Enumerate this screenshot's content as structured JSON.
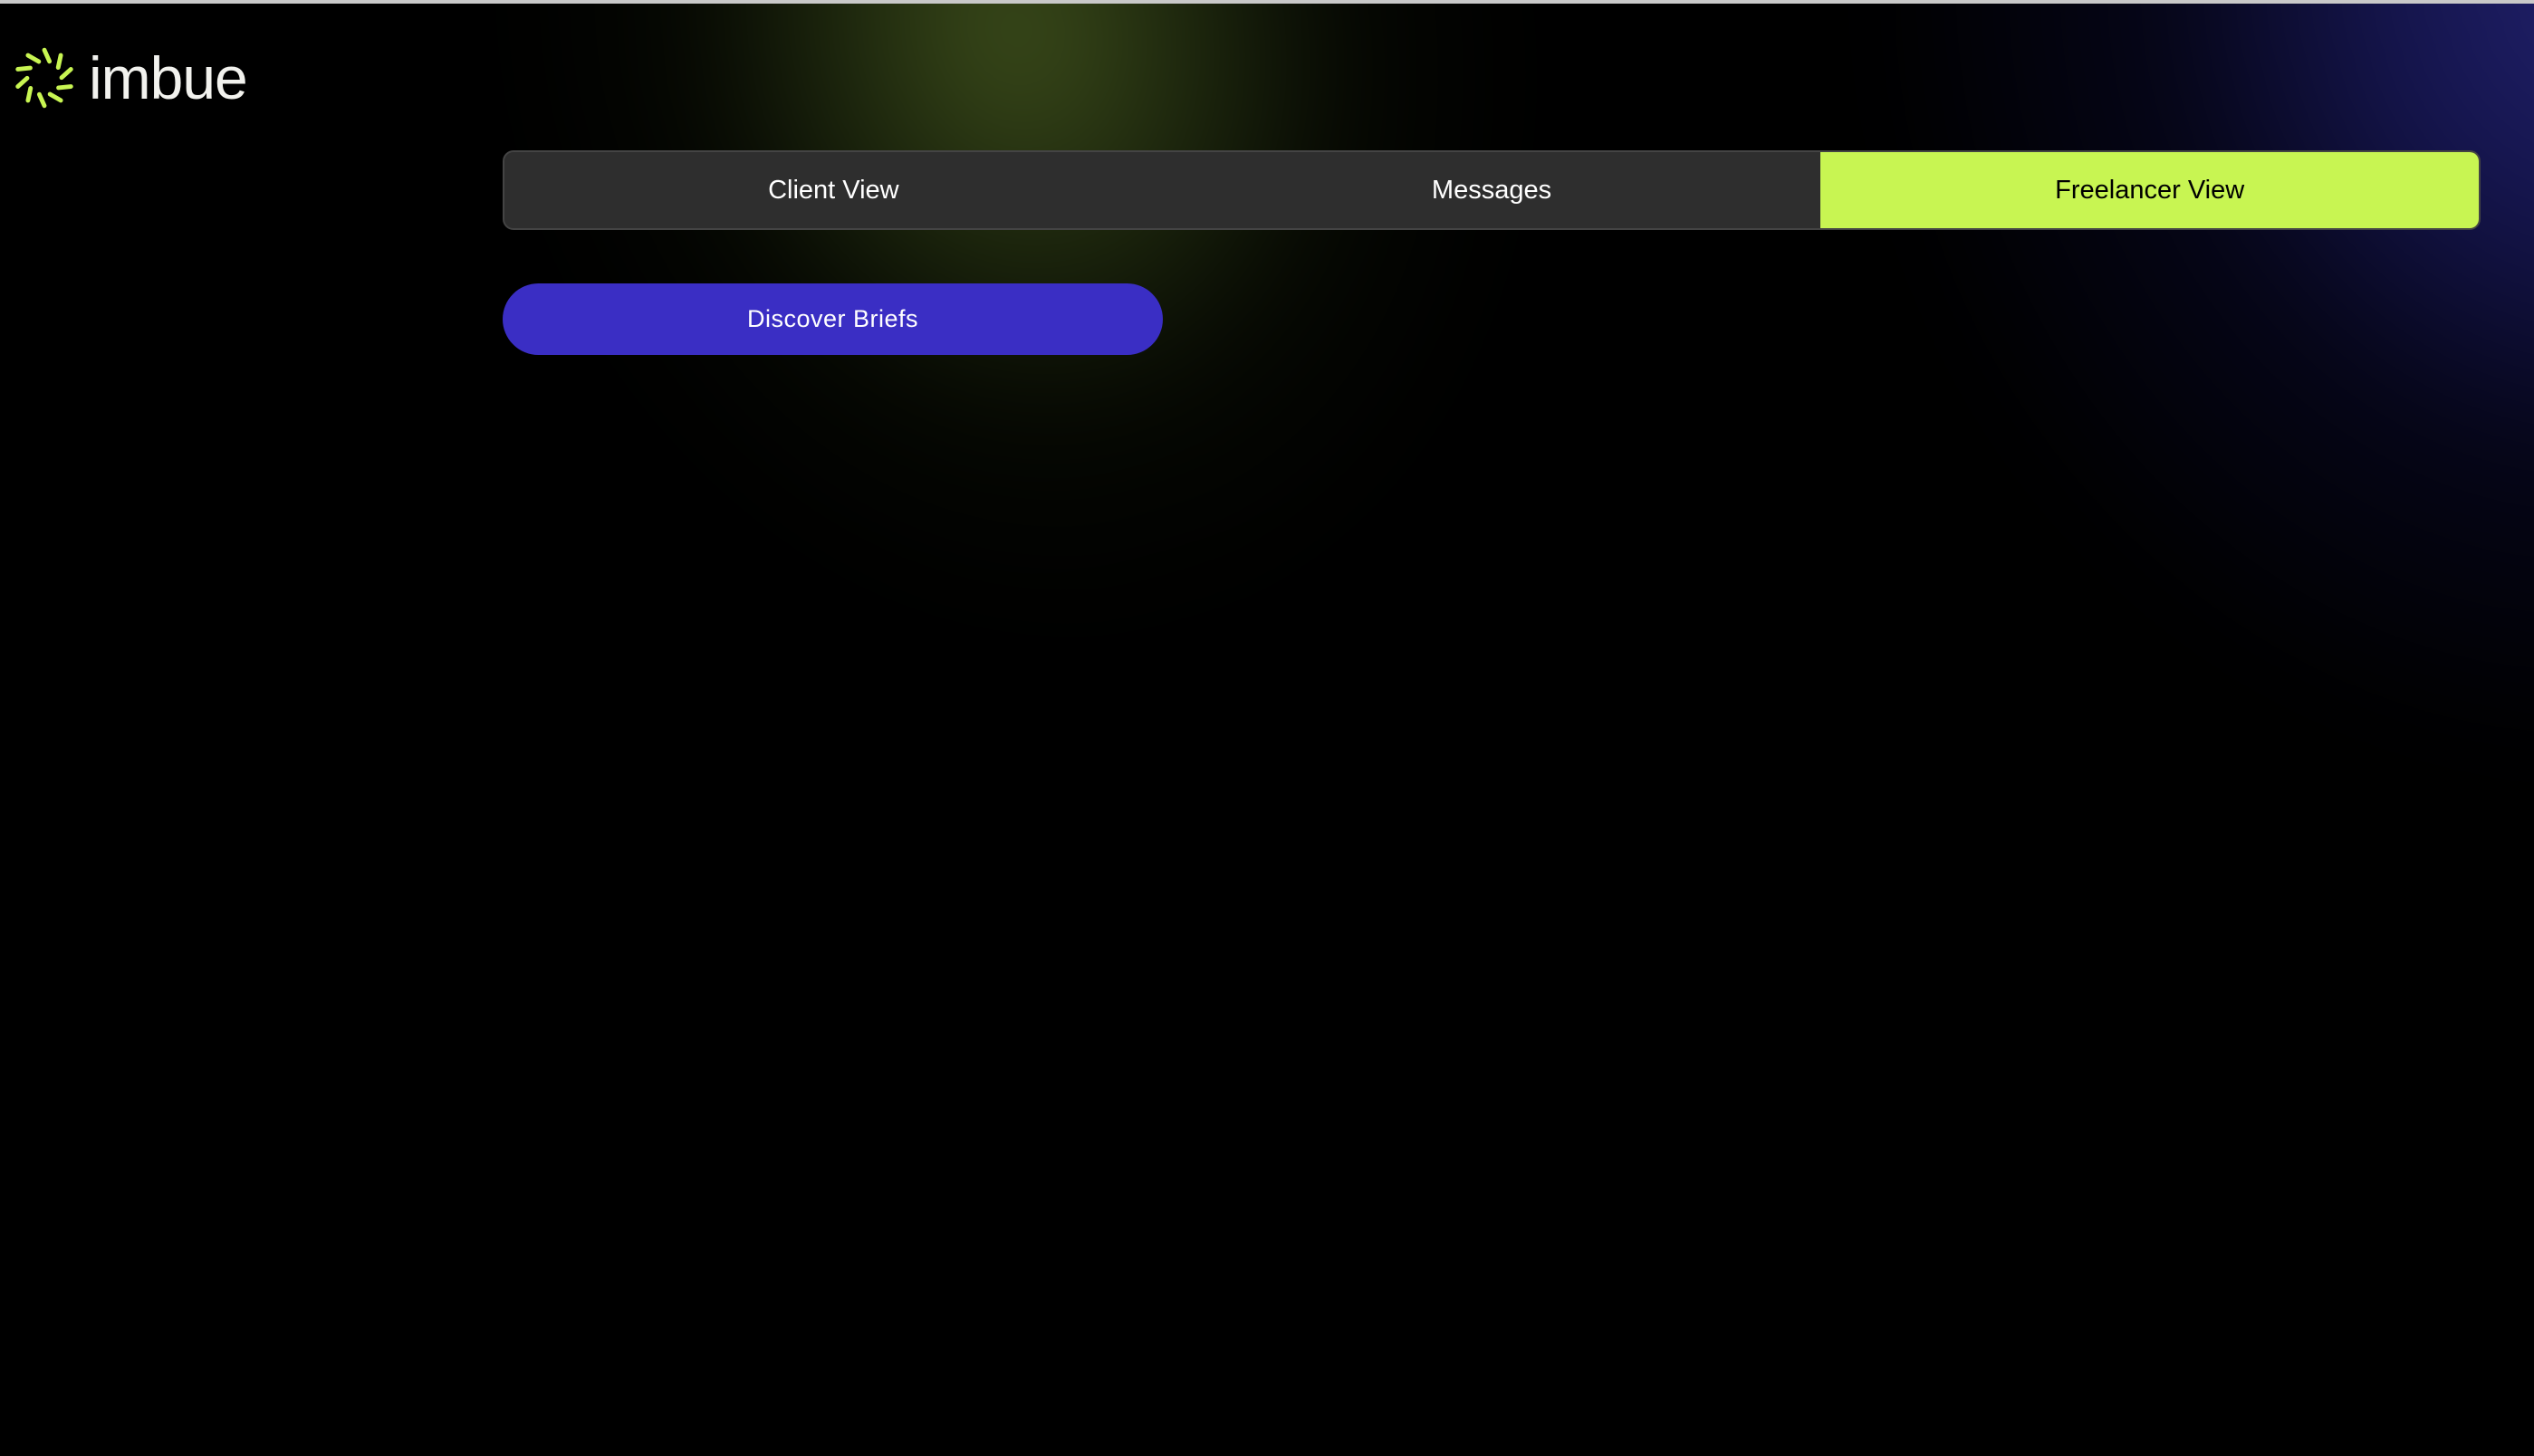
{
  "brand": {
    "name": "imbue",
    "accent_color": "#c8f552",
    "logo_icon": "sunburst-logo-icon"
  },
  "nav": {
    "tabs": [
      {
        "label": "Client View",
        "active": false
      },
      {
        "label": "Messages",
        "active": false
      },
      {
        "label": "Freelancer View",
        "active": true
      }
    ]
  },
  "main": {
    "discover_button_label": "Discover Briefs",
    "discover_button_color": "#3a2ec4"
  }
}
